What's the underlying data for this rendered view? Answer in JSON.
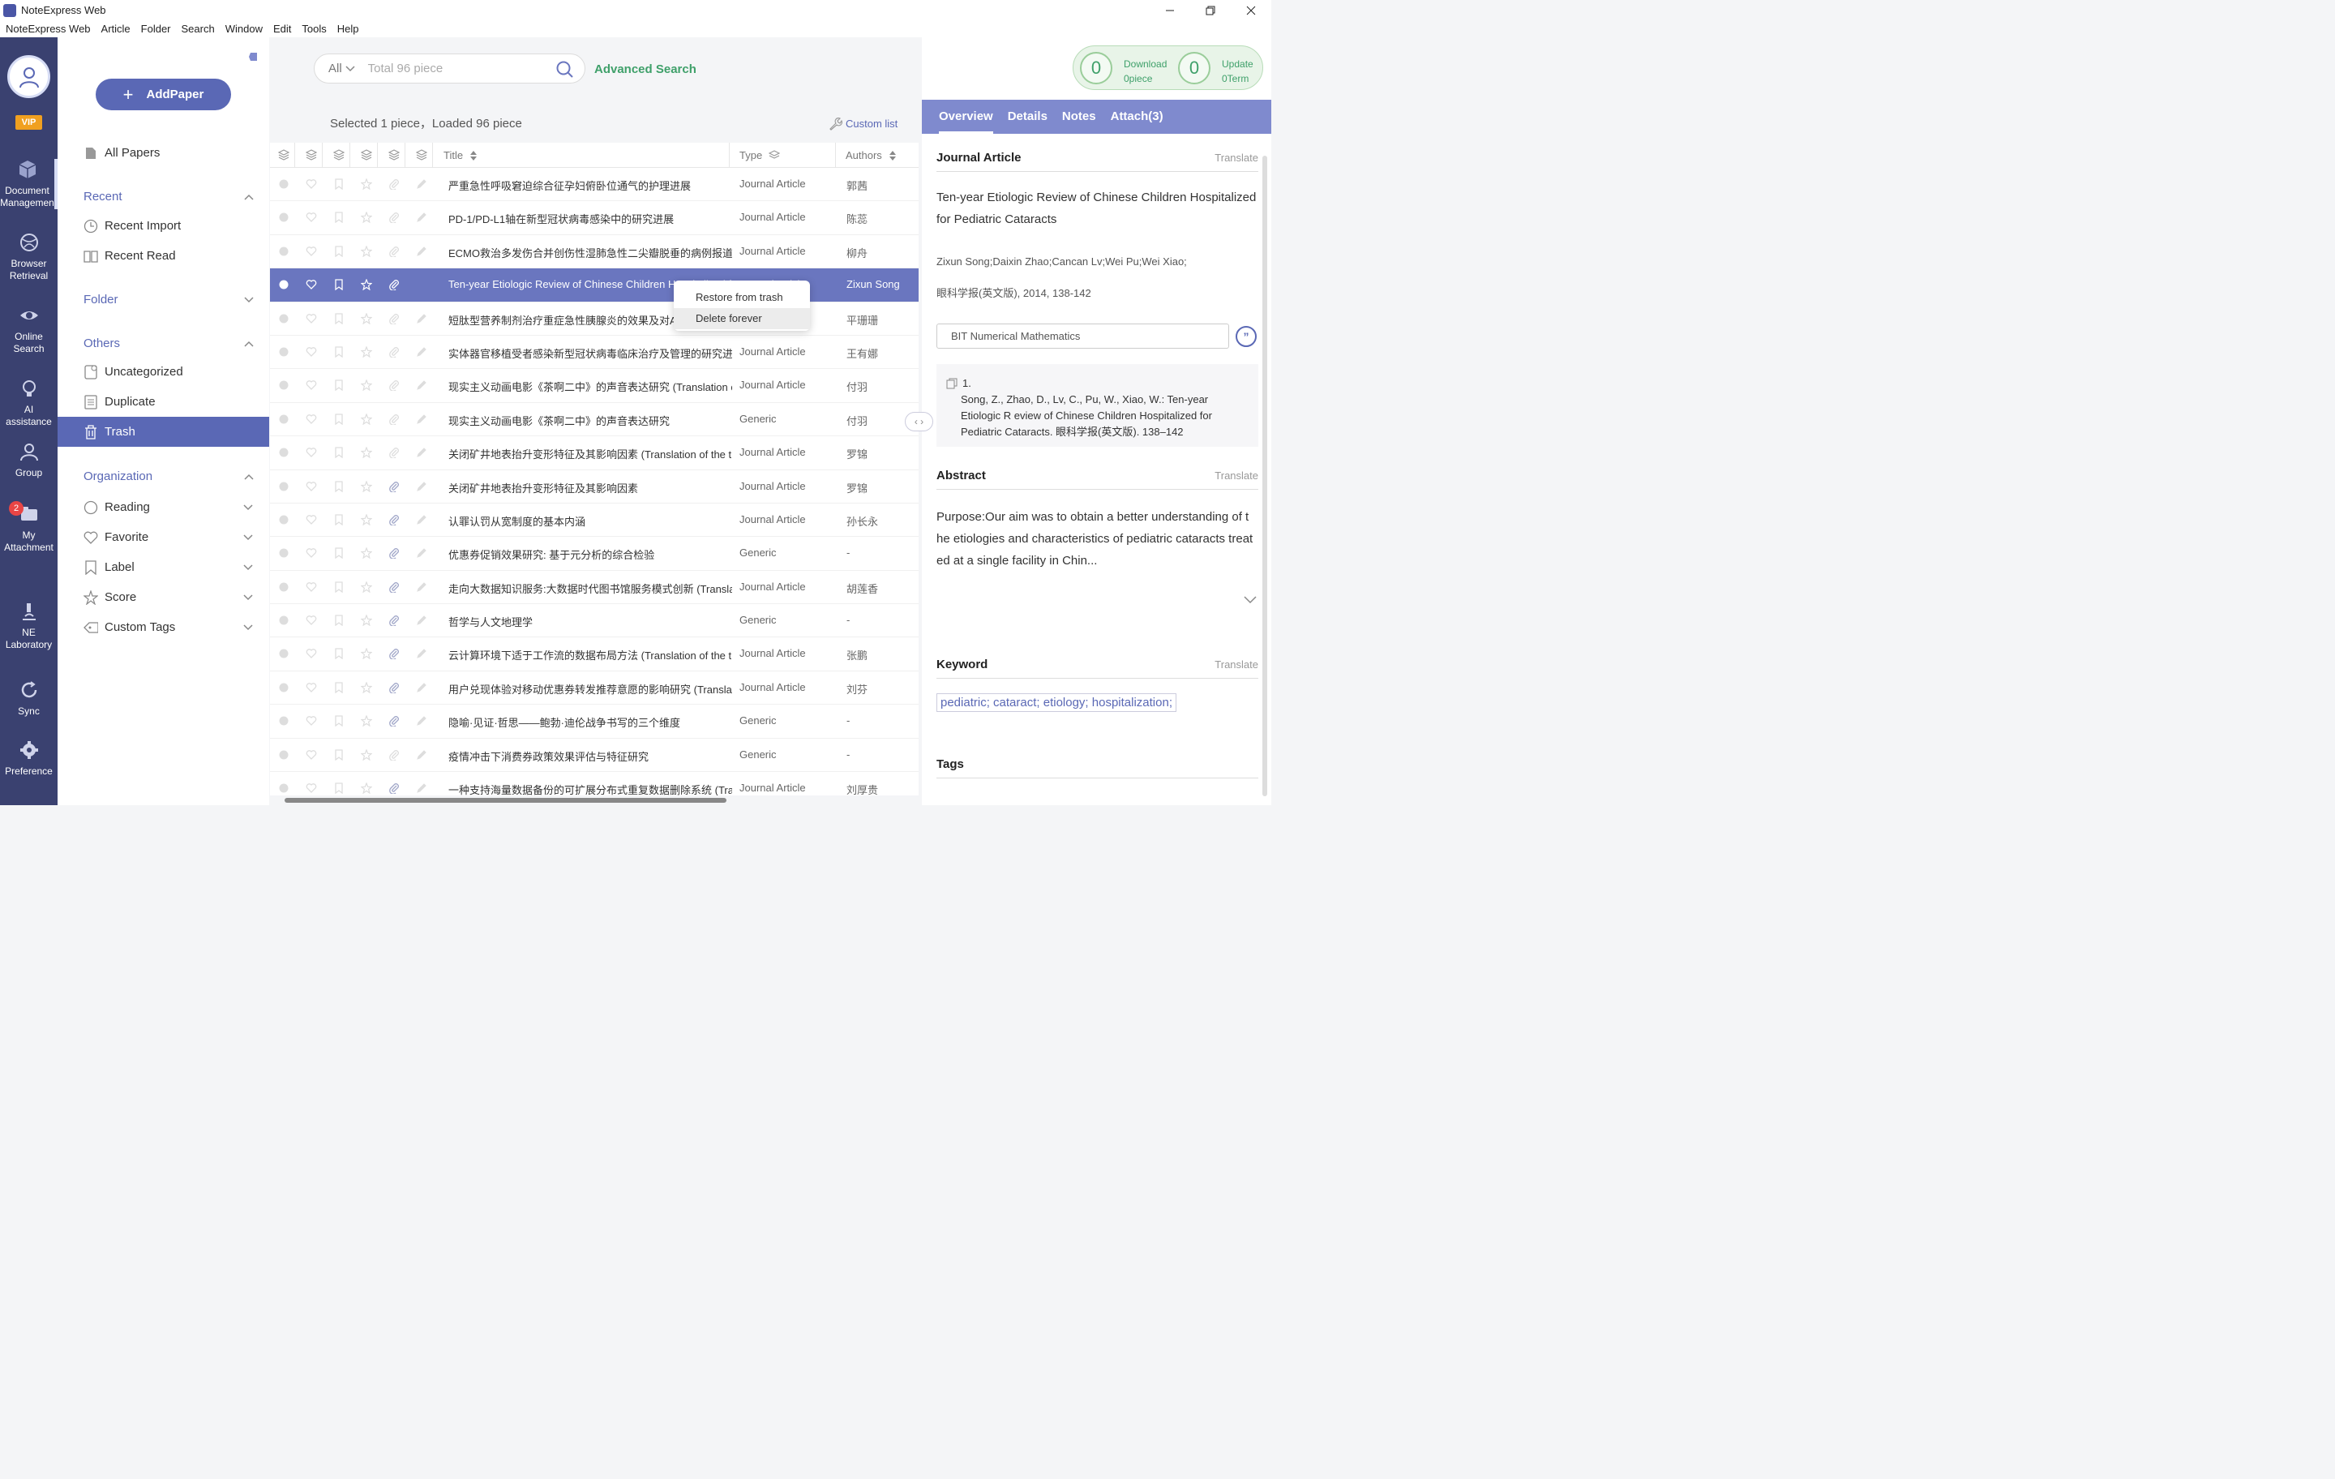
{
  "window": {
    "title": "NoteExpress Web",
    "controls": [
      "minimize",
      "restore",
      "close"
    ]
  },
  "menubar": [
    "NoteExpress Web",
    "Article",
    "Folder",
    "Search",
    "Window",
    "Edit",
    "Tools",
    "Help"
  ],
  "rail": {
    "vip": "VIP",
    "badge_count": "2",
    "items": [
      {
        "label": "Document\nManagemen",
        "icon": "cube-icon"
      },
      {
        "label": "Browser\nRetrieval",
        "icon": "globe-icon"
      },
      {
        "label": "Online\nSearch",
        "icon": "eye-icon"
      },
      {
        "label": "AI assistance",
        "icon": "bulb-icon"
      },
      {
        "label": "Group",
        "icon": "group-icon"
      },
      {
        "label": "My\nAttachment",
        "icon": "attachment-folder-icon"
      },
      {
        "label": "NE\nLaboratory",
        "icon": "microscope-icon"
      },
      {
        "label": "Sync",
        "icon": "sync-icon"
      },
      {
        "label": "Preference",
        "icon": "gear-icon"
      }
    ]
  },
  "sidebar": {
    "add_paper": "AddPaper",
    "all_papers": "All Papers",
    "recent": {
      "title": "Recent",
      "items": [
        "Recent Import",
        "Recent Read"
      ]
    },
    "folder": "Folder",
    "others": {
      "title": "Others",
      "items": [
        "Uncategorized",
        "Duplicate",
        "Trash"
      ]
    },
    "organization": {
      "title": "Organization",
      "items": [
        "Reading",
        "Favorite",
        "Label",
        "Score",
        "Custom Tags"
      ]
    }
  },
  "search": {
    "scope": "All",
    "placeholder": "Total 96 piece",
    "advanced": "Advanced Search"
  },
  "stats": {
    "download_count": "0",
    "download_label": "Download",
    "download_sub": "0piece",
    "update_count": "0",
    "update_label": "Update",
    "update_sub": "0Term"
  },
  "list": {
    "selection_text": "Selected 1 piece，Loaded 96 piece",
    "custom_list": "Custom list",
    "columns": {
      "title": "Title",
      "type": "Type",
      "authors": "Authors"
    },
    "rows": [
      {
        "title": "严重急性呼吸窘迫综合征孕妇俯卧位通气的护理进展",
        "type": "Journal Article",
        "authors": "郭茜",
        "attach": false
      },
      {
        "title": "PD-1/PD-L1轴在新型冠状病毒感染中的研究进展",
        "type": "Journal Article",
        "authors": "陈蕊",
        "attach": false
      },
      {
        "title": "ECMO救治多发伤合并创伤性湿肺急性二尖瓣脱垂的病例报道",
        "type": "Journal Article",
        "authors": "柳舟",
        "attach": false
      },
      {
        "title": "Ten-year Etiologic Review of Chinese Children Hospitalized for Pediatric Cataracts",
        "type": "Journal Article",
        "authors": "Zixun Song",
        "attach": true,
        "selected": true
      },
      {
        "title": "短肽型营养制剂治疗重症急性胰腺炎的效果及对APACHE II评分的影响",
        "type": "Journal Article",
        "authors": "平珊珊",
        "attach": false
      },
      {
        "title": "实体器官移植受者感染新型冠状病毒临床治疗及管理的研究进展",
        "type": "Journal Article",
        "authors": "王有娜",
        "attach": false
      },
      {
        "title": "现实主义动画电影《茶啊二中》的声音表达研究 (Translation of the title)",
        "type": "Journal Article",
        "authors": "付羽",
        "attach": false
      },
      {
        "title": "现实主义动画电影《茶啊二中》的声音表达研究",
        "type": "Generic",
        "authors": "付羽",
        "attach": false
      },
      {
        "title": "关闭矿井地表抬升变形特征及其影响因素 (Translation of the title)",
        "type": "Journal Article",
        "authors": "罗锦",
        "attach": false
      },
      {
        "title": "关闭矿井地表抬升变形特征及其影响因素",
        "type": "Journal Article",
        "authors": "罗锦",
        "attach": true
      },
      {
        "title": "认罪认罚从宽制度的基本内涵",
        "type": "Journal Article",
        "authors": "孙长永",
        "attach": true
      },
      {
        "title": "优惠券促销效果研究: 基于元分析的综合检验",
        "type": "Generic",
        "authors": "-",
        "attach": true
      },
      {
        "title": "走向大数据知识服务:大数据时代图书馆服务模式创新 (Translation of the title)",
        "type": "Journal Article",
        "authors": "胡莲香",
        "attach": true
      },
      {
        "title": "哲学与人文地理学",
        "type": "Generic",
        "authors": "-",
        "attach": true
      },
      {
        "title": "云计算环境下适于工作流的数据布局方法 (Translation of the title)",
        "type": "Journal Article",
        "authors": "张鹏",
        "attach": true
      },
      {
        "title": "用户兑现体验对移动优惠券转发推荐意愿的影响研究 (Translation of the title)",
        "type": "Journal Article",
        "authors": "刘芬",
        "attach": true
      },
      {
        "title": "隐喻·见证·哲思——鲍勃·迪伦战争书写的三个维度",
        "type": "Generic",
        "authors": "-",
        "attach": true
      },
      {
        "title": "疫情冲击下消费券政策效果评估与特征研究",
        "type": "Generic",
        "authors": "-",
        "attach": false
      },
      {
        "title": "一种支持海量数据备份的可扩展分布式重复数据删除系统 (Translation of the title)",
        "type": "Journal Article",
        "authors": "刘厚贵",
        "attach": true
      }
    ]
  },
  "context_menu": [
    "Restore from trash",
    "Delete forever"
  ],
  "detail": {
    "tabs": [
      "Overview",
      "Details",
      "Notes",
      "Attach(3)"
    ],
    "type_heading": "Journal Article",
    "translate": "Translate",
    "title": "Ten-year Etiologic Review of Chinese Children Hospitalized for Pediatric Cataracts",
    "authors": "Zixun Song;Daixin Zhao;Cancan Lv;Wei Pu;Wei Xiao;",
    "source": "眼科学报(英文版), 2014, 138-142",
    "citation_style": "BIT Numerical Mathematics",
    "citation_number": "1.",
    "citation_text": "Song, Z., Zhao, D., Lv, C., Pu, W., Xiao, W.: Ten-year Etiologic R eview of Chinese Children Hospitalized for Pediatric Cataracts. 眼科学报(英文版). 138–142",
    "abstract_heading": "Abstract",
    "abstract": "Purpose:Our aim was to obtain a better understanding of t he etiologies and characteristics of pediatric cataracts treat ed at a single facility in Chin...",
    "keyword_heading": "Keyword",
    "keywords": "pediatric;  cataract;  etiology;  hospitalization;",
    "tags_heading": "Tags"
  }
}
